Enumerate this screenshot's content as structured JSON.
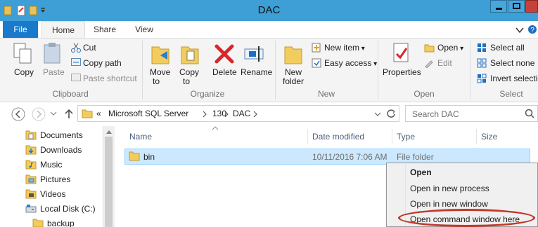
{
  "window": {
    "title": "DAC"
  },
  "ribbon_tabs": [
    "File",
    "Home",
    "Share",
    "View"
  ],
  "ribbon": {
    "clipboard": {
      "copy": "Copy",
      "paste": "Paste",
      "cut": "Cut",
      "copy_path": "Copy path",
      "paste_shortcut": "Paste shortcut",
      "group": "Clipboard"
    },
    "organize": {
      "move_to_1": "Move",
      "move_to_2": "to",
      "copy_to_1": "Copy",
      "copy_to_2": "to",
      "delete": "Delete",
      "rename": "Rename",
      "group": "Organize"
    },
    "new": {
      "new_folder_1": "New",
      "new_folder_2": "folder",
      "new_item": "New item",
      "easy_access": "Easy access",
      "group": "New"
    },
    "open": {
      "properties": "Properties",
      "open": "Open",
      "edit": "Edit",
      "group": "Open"
    },
    "select": {
      "select_all": "Select all",
      "select_none": "Select none",
      "invert_selection": "Invert selection",
      "group": "Select"
    }
  },
  "address": {
    "prefix": "«",
    "crumbs": [
      "Microsoft SQL Server",
      "130",
      "DAC"
    ]
  },
  "search": {
    "placeholder": "Search DAC"
  },
  "nav_pane": [
    "Documents",
    "Downloads",
    "Music",
    "Pictures",
    "Videos",
    "Local Disk (C:)",
    "backup"
  ],
  "columns": [
    "Name",
    "Date modified",
    "Type",
    "Size"
  ],
  "files": [
    {
      "name": "bin",
      "date": "10/11/2016 7:06 AM",
      "type": "File folder",
      "size": ""
    }
  ],
  "context_menu": [
    "Open",
    "Open in new process",
    "Open in new window",
    "Open command window here"
  ],
  "colors": {
    "title_bar": "#3d9fd6",
    "file_tab": "#1979ca",
    "selection": "#cce8ff",
    "highlight_ring": "#c0392b"
  }
}
